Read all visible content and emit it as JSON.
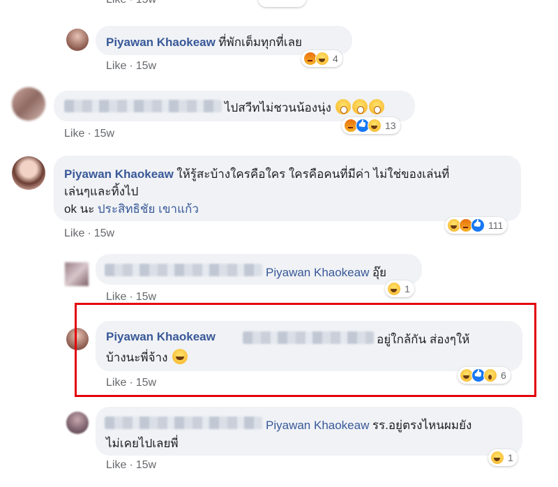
{
  "comments": [
    {
      "id": "c0",
      "author": "",
      "text": "",
      "time": "15w",
      "like": "Like",
      "reactions": [],
      "count": ""
    },
    {
      "id": "c1",
      "author": "Piyawan Khaokeaw",
      "text": "ที่พักเต็มทุกที่เลย",
      "like": "Like",
      "time": "15w",
      "reactions": [
        "angry",
        "haha"
      ],
      "count": "4"
    },
    {
      "id": "c2",
      "author": "",
      "text": "ไปสวีทไม่ชวนน้องนุ่ง",
      "like": "Like",
      "time": "15w",
      "reactions": [
        "angry",
        "like",
        "haha"
      ],
      "count": "13"
    },
    {
      "id": "c3",
      "author": "Piyawan Khaokeaw",
      "text1": "ให้รู้สะบ้างใครคือใคร ใครคือคนที่มีค่า ไม่ใช่ของเล่นที่",
      "text2": "เล่นๆและทิ้งไป",
      "text3_prefix": "ok นะ",
      "tag": "ประสิทธิชัย เขาแก้ว",
      "like": "Like",
      "time": "15w",
      "reactions": [
        "haha",
        "angry",
        "like"
      ],
      "count": "111"
    },
    {
      "id": "c4",
      "author": "",
      "tag": "Piyawan Khaokeaw",
      "text": "อุ๊ย",
      "like": "Like",
      "time": "15w",
      "reactions": [
        "haha"
      ],
      "count": "1"
    },
    {
      "id": "c5",
      "author": "Piyawan Khaokeaw",
      "text_after": "อยู่ใกล้กัน ส่องๆให้",
      "text2": "บ้างนะพี่จ้าง",
      "like": "Like",
      "time": "15w",
      "reactions": [
        "haha",
        "like",
        "wow"
      ],
      "count": "6"
    },
    {
      "id": "c6",
      "author": "",
      "tag": "Piyawan Khaokeaw",
      "text": "รร.อยู่ตรงไหนผมยัง",
      "text2": "ไม่เคยไปเลยพี่",
      "like": "Like",
      "time": "15w",
      "reactions": [
        "haha"
      ],
      "count": "1"
    }
  ],
  "colors": {
    "name": "#385898",
    "bubble": "#f0f2f5",
    "highlight": "#e3000b",
    "meta": "#65676b"
  }
}
